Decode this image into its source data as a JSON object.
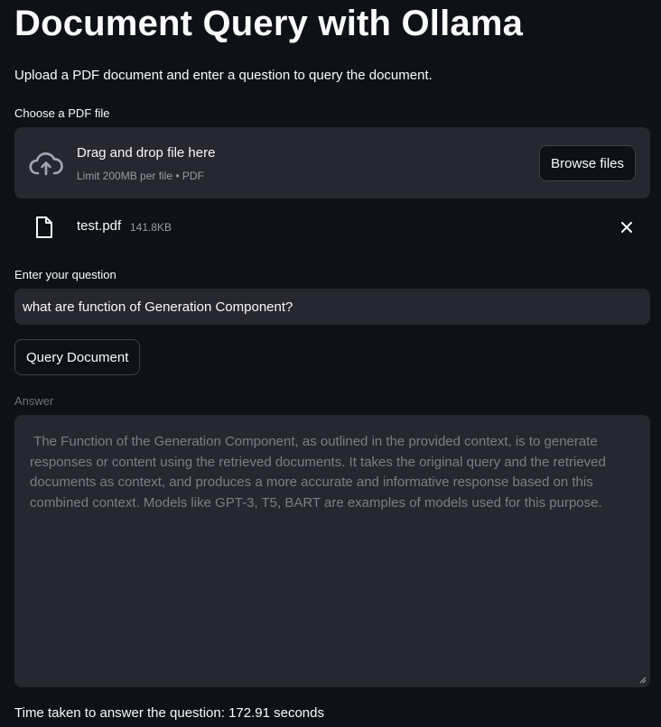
{
  "header": {
    "title": "Document Query with Ollama",
    "subtitle": "Upload a PDF document and enter a question to query the document."
  },
  "uploader": {
    "label": "Choose a PDF file",
    "drop_text": "Drag and drop file here",
    "limit_text": "Limit 200MB per file • PDF",
    "browse_label": "Browse files",
    "upload_icon": "cloud-upload-icon",
    "file": {
      "name": "test.pdf",
      "size": "141.8KB",
      "icon": "file-icon",
      "remove_icon": "close-icon"
    }
  },
  "question": {
    "label": "Enter your question",
    "value": "what are function of Generation Component?"
  },
  "query_button_label": "Query Document",
  "answer": {
    "label": "Answer",
    "text": " The Function of the Generation Component, as outlined in the provided context, is to generate responses or content using the retrieved documents. It takes the original query and the retrieved documents as context, and produces a more accurate and informative response based on this combined context. Models like GPT-3, T5, BART are examples of models used for this purpose."
  },
  "timing": {
    "text": "Time taken to answer the question: 172.91 seconds"
  },
  "colors": {
    "background": "#0e1117",
    "surface": "#262730",
    "text": "#fafafa",
    "muted": "#9a9ca5",
    "disabled_text": "#7c7e87",
    "border": "#3d3f4a"
  }
}
